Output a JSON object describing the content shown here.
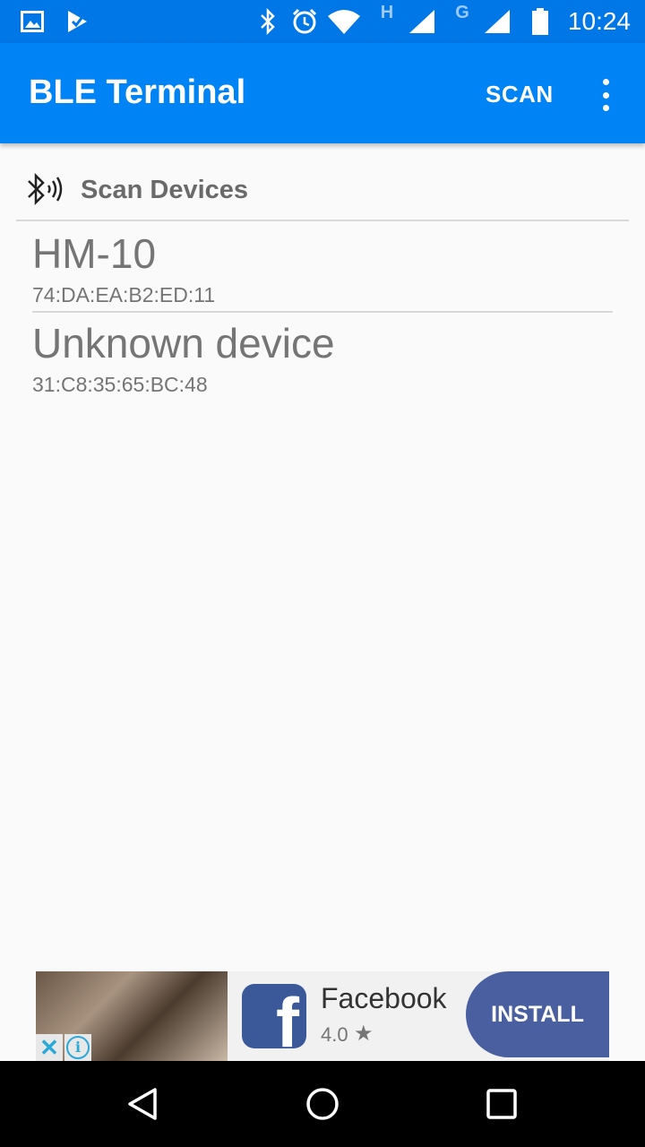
{
  "status_bar": {
    "time": "10:24",
    "network_h_label": "H",
    "network_g_label": "G",
    "icons": [
      "gallery-icon",
      "check-flag-icon",
      "bluetooth-icon",
      "alarm-icon",
      "wifi-icon",
      "signal-icon",
      "signal-icon",
      "battery-icon"
    ]
  },
  "app_bar": {
    "title": "BLE Terminal",
    "scan_label": "SCAN",
    "menu_icon": "overflow-menu-icon"
  },
  "section": {
    "icon": "bluetooth-searching-icon",
    "title": "Scan Devices"
  },
  "devices": [
    {
      "name": "HM-10",
      "address": "74:DA:EA:B2:ED:11"
    },
    {
      "name": "Unknown device",
      "address": "31:C8:35:65:BC:48"
    }
  ],
  "ad": {
    "app_name": "Facebook",
    "rating": "4.0",
    "install_label": "INSTALL",
    "close_icon": "close-icon",
    "info_icon": "info-icon"
  },
  "nav_bar": {
    "icons": [
      "back-icon",
      "home-icon",
      "recents-icon"
    ]
  },
  "colors": {
    "status_bar": "#0077e6",
    "app_bar": "#0083f5",
    "background": "#fafafa",
    "install_button": "#4a5fa0",
    "facebook_blue": "#3b5998"
  }
}
